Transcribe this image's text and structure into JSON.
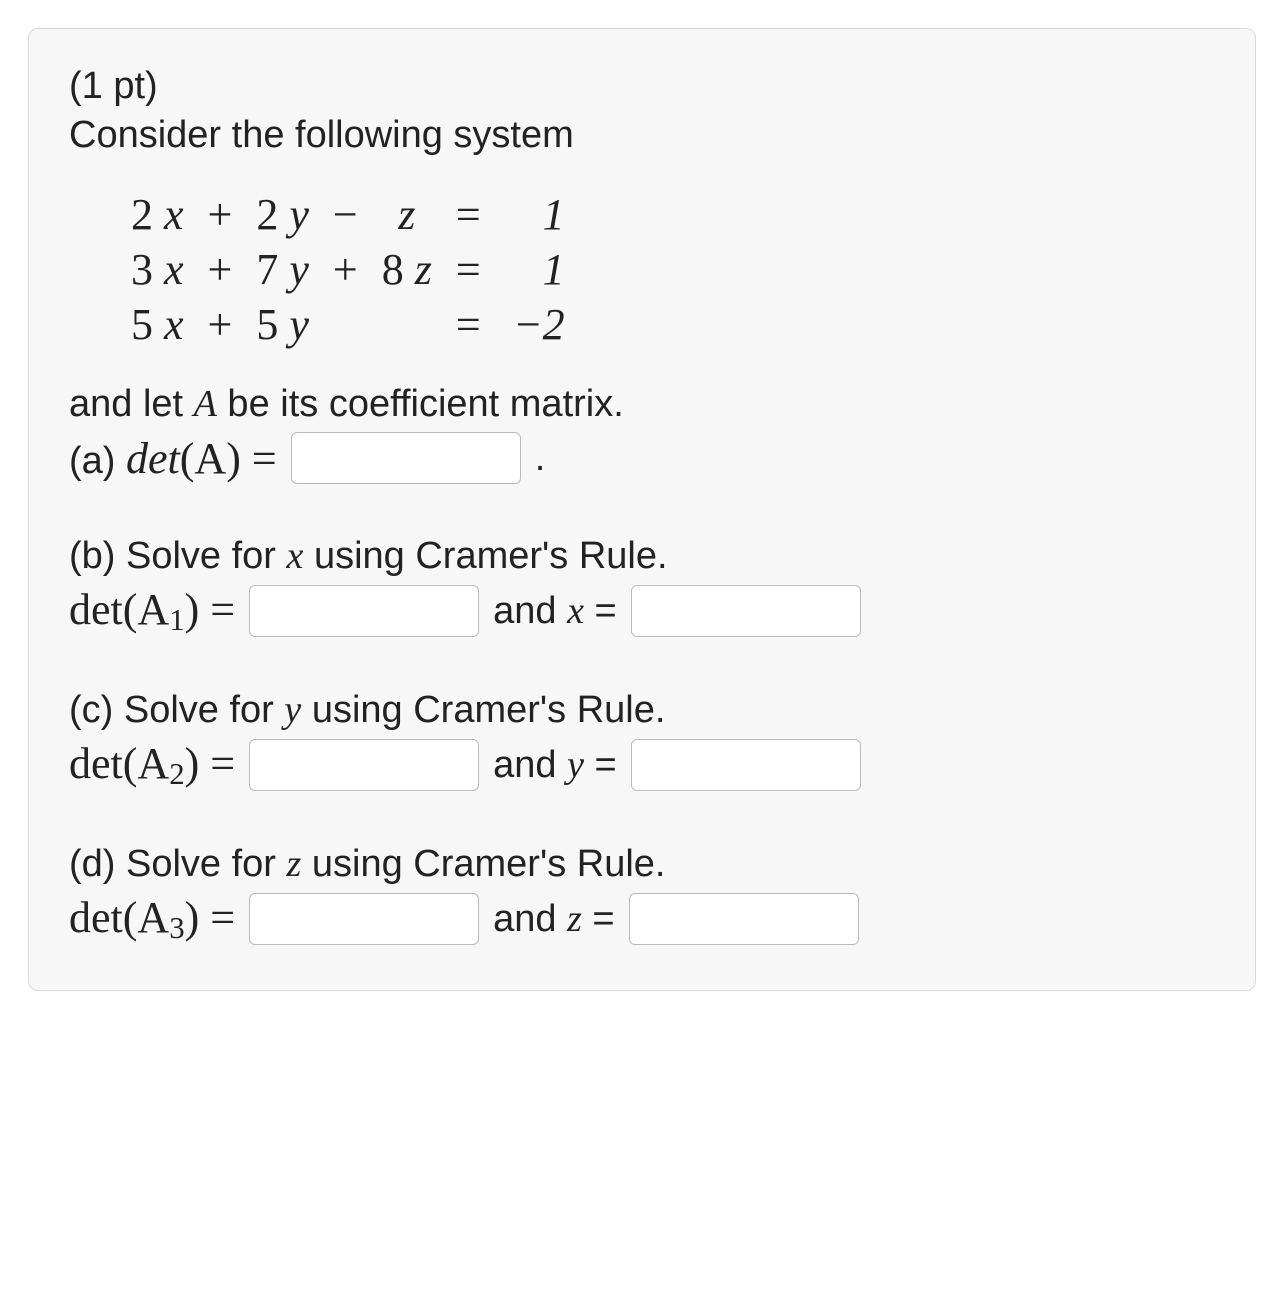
{
  "points_label": "(1 pt)",
  "prompt": "Consider the following system",
  "equations": [
    {
      "c1": "2",
      "v1": "x",
      "op1": "+",
      "c2": "2",
      "v2": "y",
      "op2": "−",
      "c3": "",
      "v3": "z",
      "eq": "=",
      "rhs": "1"
    },
    {
      "c1": "3",
      "v1": "x",
      "op1": "+",
      "c2": "7",
      "v2": "y",
      "op2": "+",
      "c3": "8",
      "v3": "z",
      "eq": "=",
      "rhs": "1"
    },
    {
      "c1": "5",
      "v1": "x",
      "op1": "+",
      "c2": "5",
      "v2": "y",
      "op2": "",
      "c3": "",
      "v3": "",
      "eq": "=",
      "rhs": "−2"
    }
  ],
  "coeff_intro_pre": "and let ",
  "coeff_intro_mid": "A",
  "coeff_intro_post": " be its coefficient matrix.",
  "parts": {
    "a": {
      "label": "(a) ",
      "det_pre": "det",
      "det_arg": "(A)",
      "eq": " = ",
      "trail": "."
    },
    "b": {
      "intro_pre": "(b) Solve for ",
      "intro_var": "x",
      "intro_post": " using Cramer's Rule.",
      "det_pre": "det",
      "det_arg_open": "(A",
      "det_sub": "1",
      "det_arg_close": ")",
      "eq": " = ",
      "and_pre": " and ",
      "and_var": "x",
      "and_post": " = "
    },
    "c": {
      "intro_pre": "(c) Solve for ",
      "intro_var": "y",
      "intro_post": " using Cramer's Rule.",
      "det_pre": "det",
      "det_arg_open": "(A",
      "det_sub": "2",
      "det_arg_close": ")",
      "eq": " = ",
      "and_pre": " and ",
      "and_var": "y",
      "and_post": " = "
    },
    "d": {
      "intro_pre": "(d) Solve for ",
      "intro_var": "z",
      "intro_post": " using Cramer's Rule.",
      "det_pre": "det",
      "det_arg_open": "(A",
      "det_sub": "3",
      "det_arg_close": ")",
      "eq": " = ",
      "and_pre": " and ",
      "and_var": "z",
      "and_post": " = "
    }
  }
}
